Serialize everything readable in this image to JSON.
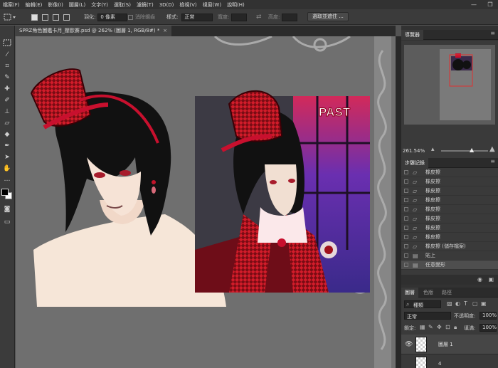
{
  "menu": {
    "items": [
      "檔案(F)",
      "編輯(E)",
      "影像(I)",
      "圖層(L)",
      "文字(Y)",
      "選取(S)",
      "濾鏡(T)",
      "3D(D)",
      "檢視(V)",
      "視窗(W)",
      "說明(H)"
    ]
  },
  "window_controls": {
    "minimize": "—",
    "restore": "❐"
  },
  "options": {
    "feather_label": "羽化:",
    "feather_value": "0 像素",
    "antialias_label": "消除鋸齒",
    "style_label": "樣式:",
    "style_value": "正常",
    "width_label": "寬度:",
    "height_label": "高度:",
    "select_mask_button": "選取並遮住 ..."
  },
  "document_tab": {
    "title": "SPRZ角色圖鑑卡月_壓歐賽.psd @ 262% (圖層 1, RGB/8#) *",
    "close": "×"
  },
  "navigator": {
    "tab": "導覽器",
    "zoom": "261.54%"
  },
  "history": {
    "tab": "步驟記錄",
    "items": [
      "橡皮擦",
      "橡皮擦",
      "橡皮擦",
      "橡皮擦",
      "橡皮擦",
      "橡皮擦",
      "橡皮擦",
      "橡皮擦",
      "橡皮擦 (儲存檔案)",
      "貼上",
      "任意變形"
    ]
  },
  "layers": {
    "tabs": [
      "圖層",
      "色版",
      "路徑"
    ],
    "filter_kind": "種類",
    "blend_mode": "正常",
    "opacity_label": "不透明度:",
    "opacity_value": "100%",
    "lock_label": "鎖定:",
    "fill_label": "填滿:",
    "fill_value": "100%",
    "items": [
      {
        "name": "圖層 1",
        "visible": true
      },
      {
        "name": "4",
        "visible": false
      }
    ]
  },
  "artwork": {
    "badge_text": "PAST"
  },
  "colors": {
    "menubar_bg": "#323232",
    "panel_bg": "#3a3a3a",
    "canvas_bg": "#6f6f6f",
    "accent_red": "#c8102e"
  }
}
